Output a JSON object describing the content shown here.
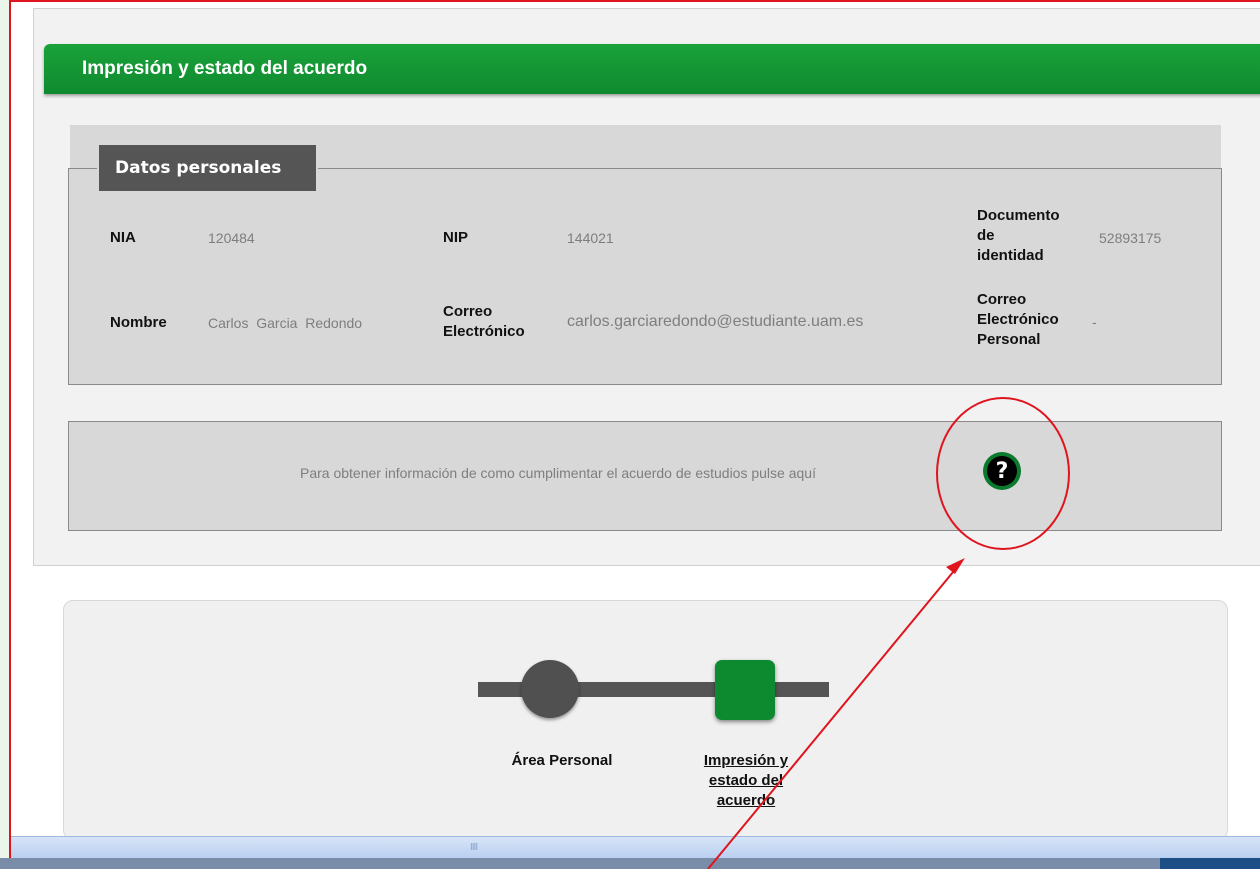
{
  "header": {
    "title": "Impresión y estado del acuerdo"
  },
  "personal_data": {
    "legend": "Datos personales",
    "nia_label": "NIA",
    "nia_value": "120484",
    "nip_label": "NIP",
    "nip_value": "144021",
    "doc_label_line1": "Documento",
    "doc_label_line2": "de",
    "doc_label_line3": "identidad",
    "doc_value": "52893175",
    "nombre_label": "Nombre",
    "nombre_value": "Carlos  Garcia  Redondo",
    "correo_label_line1": "Correo",
    "correo_label_line2": "Electrónico",
    "correo_value": "carlos.garciaredondo@estudiante.uam.es",
    "correo_personal_line1": "Correo",
    "correo_personal_line2": "Electrónico",
    "correo_personal_line3": "Personal",
    "correo_personal_value": "-"
  },
  "info": {
    "text": "Para obtener información de como cumplimentar el acuerdo de estudios pulse aquí",
    "help_icon": "?"
  },
  "steps": {
    "step1_label": "Área Personal",
    "step2_line1": "Impresión y",
    "step2_line2": "estado del",
    "step2_line3": "acuerdo"
  },
  "scrollbar": {
    "grip": "IIII"
  },
  "colors": {
    "brand_green": "#0f8a2f",
    "annotation_red": "#e0141e",
    "panel_gray": "#d8d8d8"
  }
}
